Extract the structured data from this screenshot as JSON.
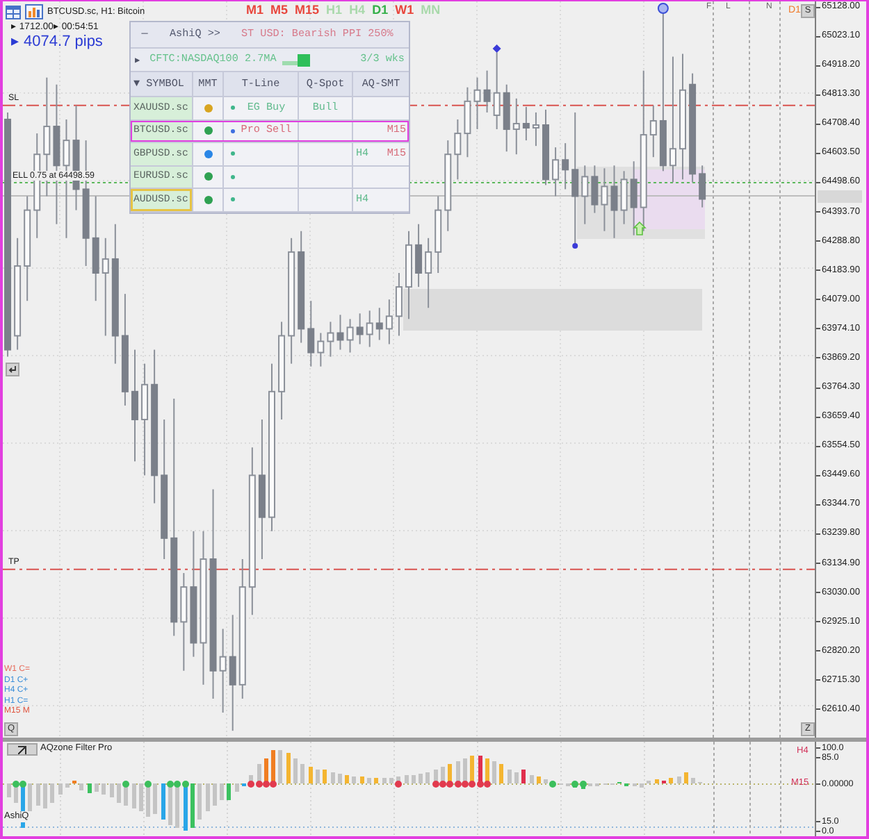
{
  "chart_header": {
    "title": "BTCUSD.sc, H1: Bitcoin",
    "info": "▸ 1712.00▸ 00:54:51",
    "pips": "▸ 4074.7 pips"
  },
  "timeframes": [
    {
      "label": "M1",
      "color": "#e8463c"
    },
    {
      "label": "M5",
      "color": "#e8463c"
    },
    {
      "label": "M15",
      "color": "#e8463c"
    },
    {
      "label": "H1",
      "color": "#a9d9ab"
    },
    {
      "label": "H4",
      "color": "#a9d9ab"
    },
    {
      "label": "D1",
      "color": "#36b04a"
    },
    {
      "label": "W1",
      "color": "#e8463c"
    },
    {
      "label": "MN",
      "color": "#a9d9ab"
    }
  ],
  "dashboard": {
    "minimize_button": "—",
    "title": "AshiQ >>",
    "headline": "ST USD: Bearish PPI 250%",
    "expand_arrow": "▶",
    "cftc": "CFTC:NASDAQ100 2.7MA",
    "weeks": "3/3 wks",
    "columns": [
      "▼ SYMBOL",
      "MMT",
      "T-Line",
      "Q-Spot",
      "AQ-SMT"
    ],
    "rows": [
      {
        "symbol": "XAUUSD.sc",
        "selected": false,
        "highlighted": false,
        "mmt": {
          "color": "#d8a521"
        },
        "tline_dot": {
          "color": "#3fb68b"
        },
        "tline": {
          "text": "EG Buy",
          "color": "#62bb8e"
        },
        "qspot": {
          "text": "Bull",
          "color": "#62bb8e"
        }
      },
      {
        "symbol": "BTCUSD.sc",
        "selected": true,
        "highlighted": false,
        "mmt": {
          "color": "#2fa152"
        },
        "tline_dot": {
          "color": "#3f6fe0"
        },
        "tline": {
          "text": "Pro Sell",
          "color": "#d76a78"
        },
        "aq_smt_right": {
          "text": "M15",
          "color": "#d76a78"
        }
      },
      {
        "symbol": "GBPUSD.sc",
        "selected": false,
        "highlighted": false,
        "mmt": {
          "color": "#2a86e6"
        },
        "tline_dot": {
          "color": "#3fb68b"
        },
        "aq_smt_left": {
          "text": "H4",
          "color": "#62bb8e"
        },
        "aq_smt_right": {
          "text": "M15",
          "color": "#d76a78"
        }
      },
      {
        "symbol": "EURUSD.sc",
        "selected": false,
        "highlighted": false,
        "mmt": {
          "color": "#2fa152"
        },
        "tline_dot": {
          "color": "#3fb68b"
        }
      },
      {
        "symbol": "AUDUSD.sc",
        "selected": false,
        "highlighted": true,
        "mmt": {
          "color": "#2fa152"
        },
        "tline_dot": {
          "color": "#3fb68b"
        },
        "aq_smt_left": {
          "text": "H4",
          "color": "#62bb8e"
        }
      }
    ]
  },
  "price_levels": [
    {
      "kind": "stop"
    },
    {
      "kind": "entry"
    },
    {
      "kind": "bid"
    },
    {
      "kind": "target"
    }
  ],
  "session_markers": [
    "F",
    "L",
    "N"
  ],
  "corner_label": "D1",
  "chart_buttons": {
    "top_right": "S",
    "bottom_left": "Q",
    "bottom_right": "Z"
  },
  "trend_status": [
    {
      "label": "W1 C=",
      "color": "#e66b5b"
    },
    {
      "label": "D1 C+",
      "color": "#3b8fd9"
    },
    {
      "label": "H4 C+",
      "color": "#3b8fd9"
    },
    {
      "label": "H1 C=",
      "color": "#3b8fd9"
    },
    {
      "label": "M15 M",
      "color": "#e0553f"
    }
  ],
  "chart": {
    "chart_data": {
      "type": "candlestick",
      "grid": true,
      "categories": [
        null,
        null,
        null,
        null,
        null,
        null,
        null,
        null,
        null,
        null,
        null,
        null,
        null,
        null,
        null,
        null,
        null,
        null,
        null,
        null,
        null,
        null,
        null,
        null,
        null,
        null,
        null,
        null,
        null,
        null,
        null,
        null,
        null,
        null,
        null,
        null,
        null,
        null,
        null,
        null,
        null,
        null,
        null,
        null,
        null,
        null,
        null,
        null,
        null,
        null,
        null,
        null,
        null,
        null,
        null,
        null,
        null,
        null,
        null,
        null,
        null,
        null,
        null,
        null,
        null,
        null,
        null,
        null,
        null,
        null,
        null,
        null,
        null,
        null,
        null,
        null,
        null,
        null,
        null,
        null,
        null,
        null,
        null
      ],
      "ohlc": [
        [
          64725,
          64750,
          63875,
          63900
        ],
        [
          63950,
          64300,
          63900,
          64200
        ],
        [
          64200,
          64450,
          64075,
          64400
        ],
        [
          64400,
          64675,
          64300,
          64600
        ],
        [
          64600,
          64875,
          64450,
          64700
        ],
        [
          64700,
          64850,
          64350,
          64560
        ],
        [
          64560,
          64725,
          64300,
          64650
        ],
        [
          64650,
          64775,
          64400,
          64475
        ],
        [
          64475,
          64650,
          64200,
          64300
        ],
        [
          64300,
          64450,
          64075,
          64175
        ],
        [
          64175,
          64300,
          63950,
          64225
        ],
        [
          64225,
          64350,
          63850,
          63950
        ],
        [
          63950,
          64100,
          63700,
          63750
        ],
        [
          63750,
          63900,
          63500,
          63650
        ],
        [
          63650,
          63850,
          63450,
          63775
        ],
        [
          63775,
          63900,
          63350,
          63450
        ],
        [
          63450,
          63650,
          63150,
          63225
        ],
        [
          63225,
          63725,
          62875,
          62925
        ],
        [
          62925,
          63100,
          62750,
          63050
        ],
        [
          63050,
          63250,
          62800,
          62850
        ],
        [
          62850,
          63250,
          62700,
          63150
        ],
        [
          63150,
          63400,
          62650,
          62750
        ],
        [
          62750,
          62900,
          62600,
          62800
        ],
        [
          62800,
          62950,
          62535,
          62700
        ],
        [
          62700,
          63150,
          62650,
          63050
        ],
        [
          63050,
          63550,
          62950,
          63450
        ],
        [
          63450,
          63650,
          63150,
          63300
        ],
        [
          63300,
          63850,
          63250,
          63750
        ],
        [
          63750,
          64000,
          63650,
          63950
        ],
        [
          63950,
          64300,
          63850,
          64250
        ],
        [
          64250,
          64325,
          63925,
          63975
        ],
        [
          63975,
          64075,
          63840,
          63890
        ],
        [
          63890,
          63960,
          63840,
          63930
        ],
        [
          63930,
          64000,
          63875,
          63960
        ],
        [
          63960,
          64025,
          63900,
          63935
        ],
        [
          63935,
          64010,
          63890,
          63980
        ],
        [
          63980,
          64030,
          63920,
          63955
        ],
        [
          63955,
          64040,
          63910,
          63995
        ],
        [
          63995,
          64050,
          63935,
          63975
        ],
        [
          63975,
          64080,
          63920,
          64020
        ],
        [
          64020,
          64175,
          63950,
          64125
        ],
        [
          64125,
          64325,
          64010,
          64275
        ],
        [
          64275,
          64350,
          64125,
          64175
        ],
        [
          64175,
          64300,
          64050,
          64250
        ],
        [
          64250,
          64450,
          64175,
          64400
        ],
        [
          64400,
          64650,
          64325,
          64600
        ],
        [
          64600,
          64725,
          64510,
          64675
        ],
        [
          64675,
          64840,
          64590,
          64790
        ],
        [
          64790,
          64875,
          64690,
          64830
        ],
        [
          64830,
          64900,
          64750,
          64790
        ],
        [
          64740,
          64965,
          64690,
          64820
        ],
        [
          64820,
          64850,
          64610,
          64690
        ],
        [
          64690,
          64800,
          64600,
          64710
        ],
        [
          64710,
          64770,
          64650,
          64695
        ],
        [
          64695,
          64750,
          64630,
          64705
        ],
        [
          64705,
          64760,
          64490,
          64510
        ],
        [
          64510,
          64625,
          64450,
          64580
        ],
        [
          64580,
          64640,
          64475,
          64545
        ],
        [
          64545,
          64750,
          64280,
          64450
        ],
        [
          64450,
          64560,
          64350,
          64520
        ],
        [
          64520,
          64560,
          64390,
          64420
        ],
        [
          64420,
          64550,
          64325,
          64485
        ],
        [
          64485,
          64560,
          64300,
          64400
        ],
        [
          64400,
          64540,
          64350,
          64510
        ],
        [
          64510,
          64575,
          64310,
          64410
        ],
        [
          64410,
          64900,
          64325,
          64670
        ],
        [
          64670,
          64775,
          64590,
          64720
        ],
        [
          64720,
          65110,
          64540,
          64560
        ],
        [
          64560,
          64950,
          64500,
          64620
        ],
        [
          64620,
          64960,
          64510,
          64830
        ],
        [
          64850,
          64890,
          64500,
          64530
        ],
        [
          64530,
          64560,
          64410,
          64440
        ],
        null,
        null,
        null,
        null,
        null,
        null,
        null,
        null,
        null,
        null,
        null
      ],
      "ylim": [
        62510.5,
        65147.9
      ],
      "yticks": [
        {
          "value": 65128,
          "label": "65128.00"
        },
        {
          "value": 65023.1,
          "label": "65023.10"
        },
        {
          "value": 64918.2,
          "label": "64918.20"
        },
        {
          "value": 64813.3,
          "label": "64813.30"
        },
        {
          "value": 64708.4,
          "label": "64708.40"
        },
        {
          "value": 64603.5,
          "label": "64603.50"
        },
        {
          "value": 64498.6,
          "label": "64498.60"
        },
        {
          "value": 64393.7,
          "label": "64393.70"
        },
        {
          "value": 64288.8,
          "label": "64288.80"
        },
        {
          "value": 64183.9,
          "label": "64183.90"
        },
        {
          "value": 64079,
          "label": "64079.00"
        },
        {
          "value": 63974.1,
          "label": "63974.10"
        },
        {
          "value": 63869.2,
          "label": "63869.20"
        },
        {
          "value": 63764.3,
          "label": "63764.30"
        },
        {
          "value": 63659.4,
          "label": "63659.40"
        },
        {
          "value": 63554.5,
          "label": "63554.50"
        },
        {
          "value": 63449.6,
          "label": "63449.60"
        },
        {
          "value": 63344.7,
          "label": "63344.70"
        },
        {
          "value": 63239.8,
          "label": "63239.80"
        },
        {
          "value": 63134.9,
          "label": "63134.90"
        },
        {
          "value": 63030,
          "label": "63030.00"
        },
        {
          "value": 62925.1,
          "label": "62925.10"
        },
        {
          "value": 62820.2,
          "label": "62820.20"
        },
        {
          "value": 62715.3,
          "label": "62715.30"
        },
        {
          "value": 62610.4,
          "label": "62610.40"
        }
      ],
      "ref_lines": [
        {
          "axis": "y",
          "value": 64775,
          "label": "SL",
          "color": "#d9534f"
        },
        {
          "axis": "y",
          "value": 64498.59,
          "label": "ELL 0.75 at 64498.59",
          "color": "#5cb85c"
        },
        {
          "axis": "y",
          "value": 64451,
          "color": "#bdbdbd"
        },
        {
          "axis": "y",
          "value": 63113,
          "label": "TP",
          "color": "#d9534f"
        }
      ]
    }
  },
  "indicator": {
    "name": "AQzone Filter Pro",
    "label": "AshiQ",
    "axis": [
      "100.0",
      "85.0",
      "0.00000",
      "15.0",
      "0.0"
    ],
    "tags": [
      "H4",
      "M15"
    ]
  }
}
